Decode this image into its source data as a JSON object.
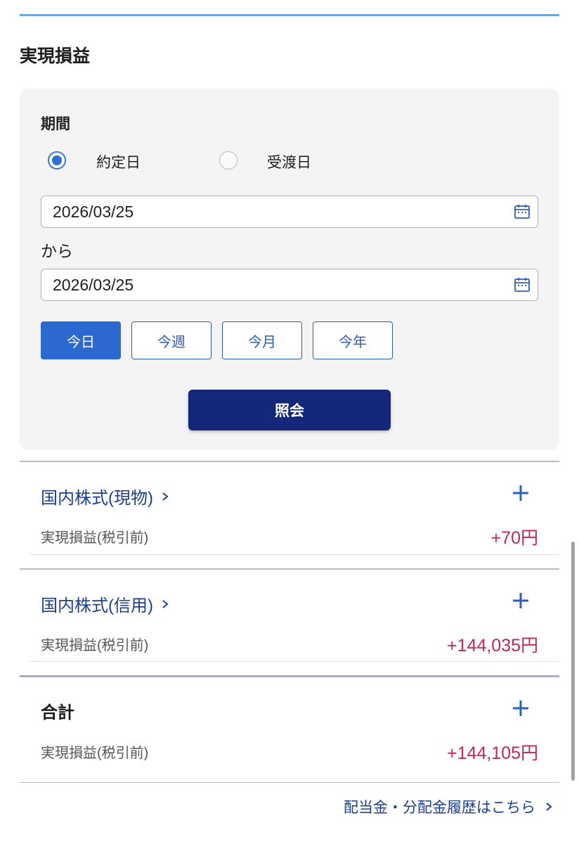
{
  "section_title": "実現損益",
  "filter": {
    "period_label": "期間",
    "radio_options": [
      {
        "label": "約定日",
        "selected": true
      },
      {
        "label": "受渡日",
        "selected": false
      }
    ],
    "date_from": "2026/03/25",
    "from_suffix": "から",
    "date_to": "2026/03/25",
    "quick_buttons": [
      {
        "label": "今日",
        "active": true
      },
      {
        "label": "今週",
        "active": false
      },
      {
        "label": "今月",
        "active": false
      },
      {
        "label": "今年",
        "active": false
      }
    ],
    "search_label": "照会"
  },
  "categories": [
    {
      "title": "国内株式(現物)",
      "row_label": "実現損益(税引前)",
      "value": "+70円"
    },
    {
      "title": "国内株式(信用)",
      "row_label": "実現損益(税引前)",
      "value": "+144,035円"
    }
  ],
  "total": {
    "title": "合計",
    "row_label": "実現損益(税引前)",
    "value": "+144,105円"
  },
  "footer_link": "配当金・分配金履歴はこちら",
  "colors": {
    "accent": "#2b69d0",
    "navy": "#14287a",
    "link": "#1b3f8f",
    "positive": "#c6275a"
  },
  "icons": [
    "calendar-icon",
    "chevron-right-icon",
    "plus-icon"
  ]
}
